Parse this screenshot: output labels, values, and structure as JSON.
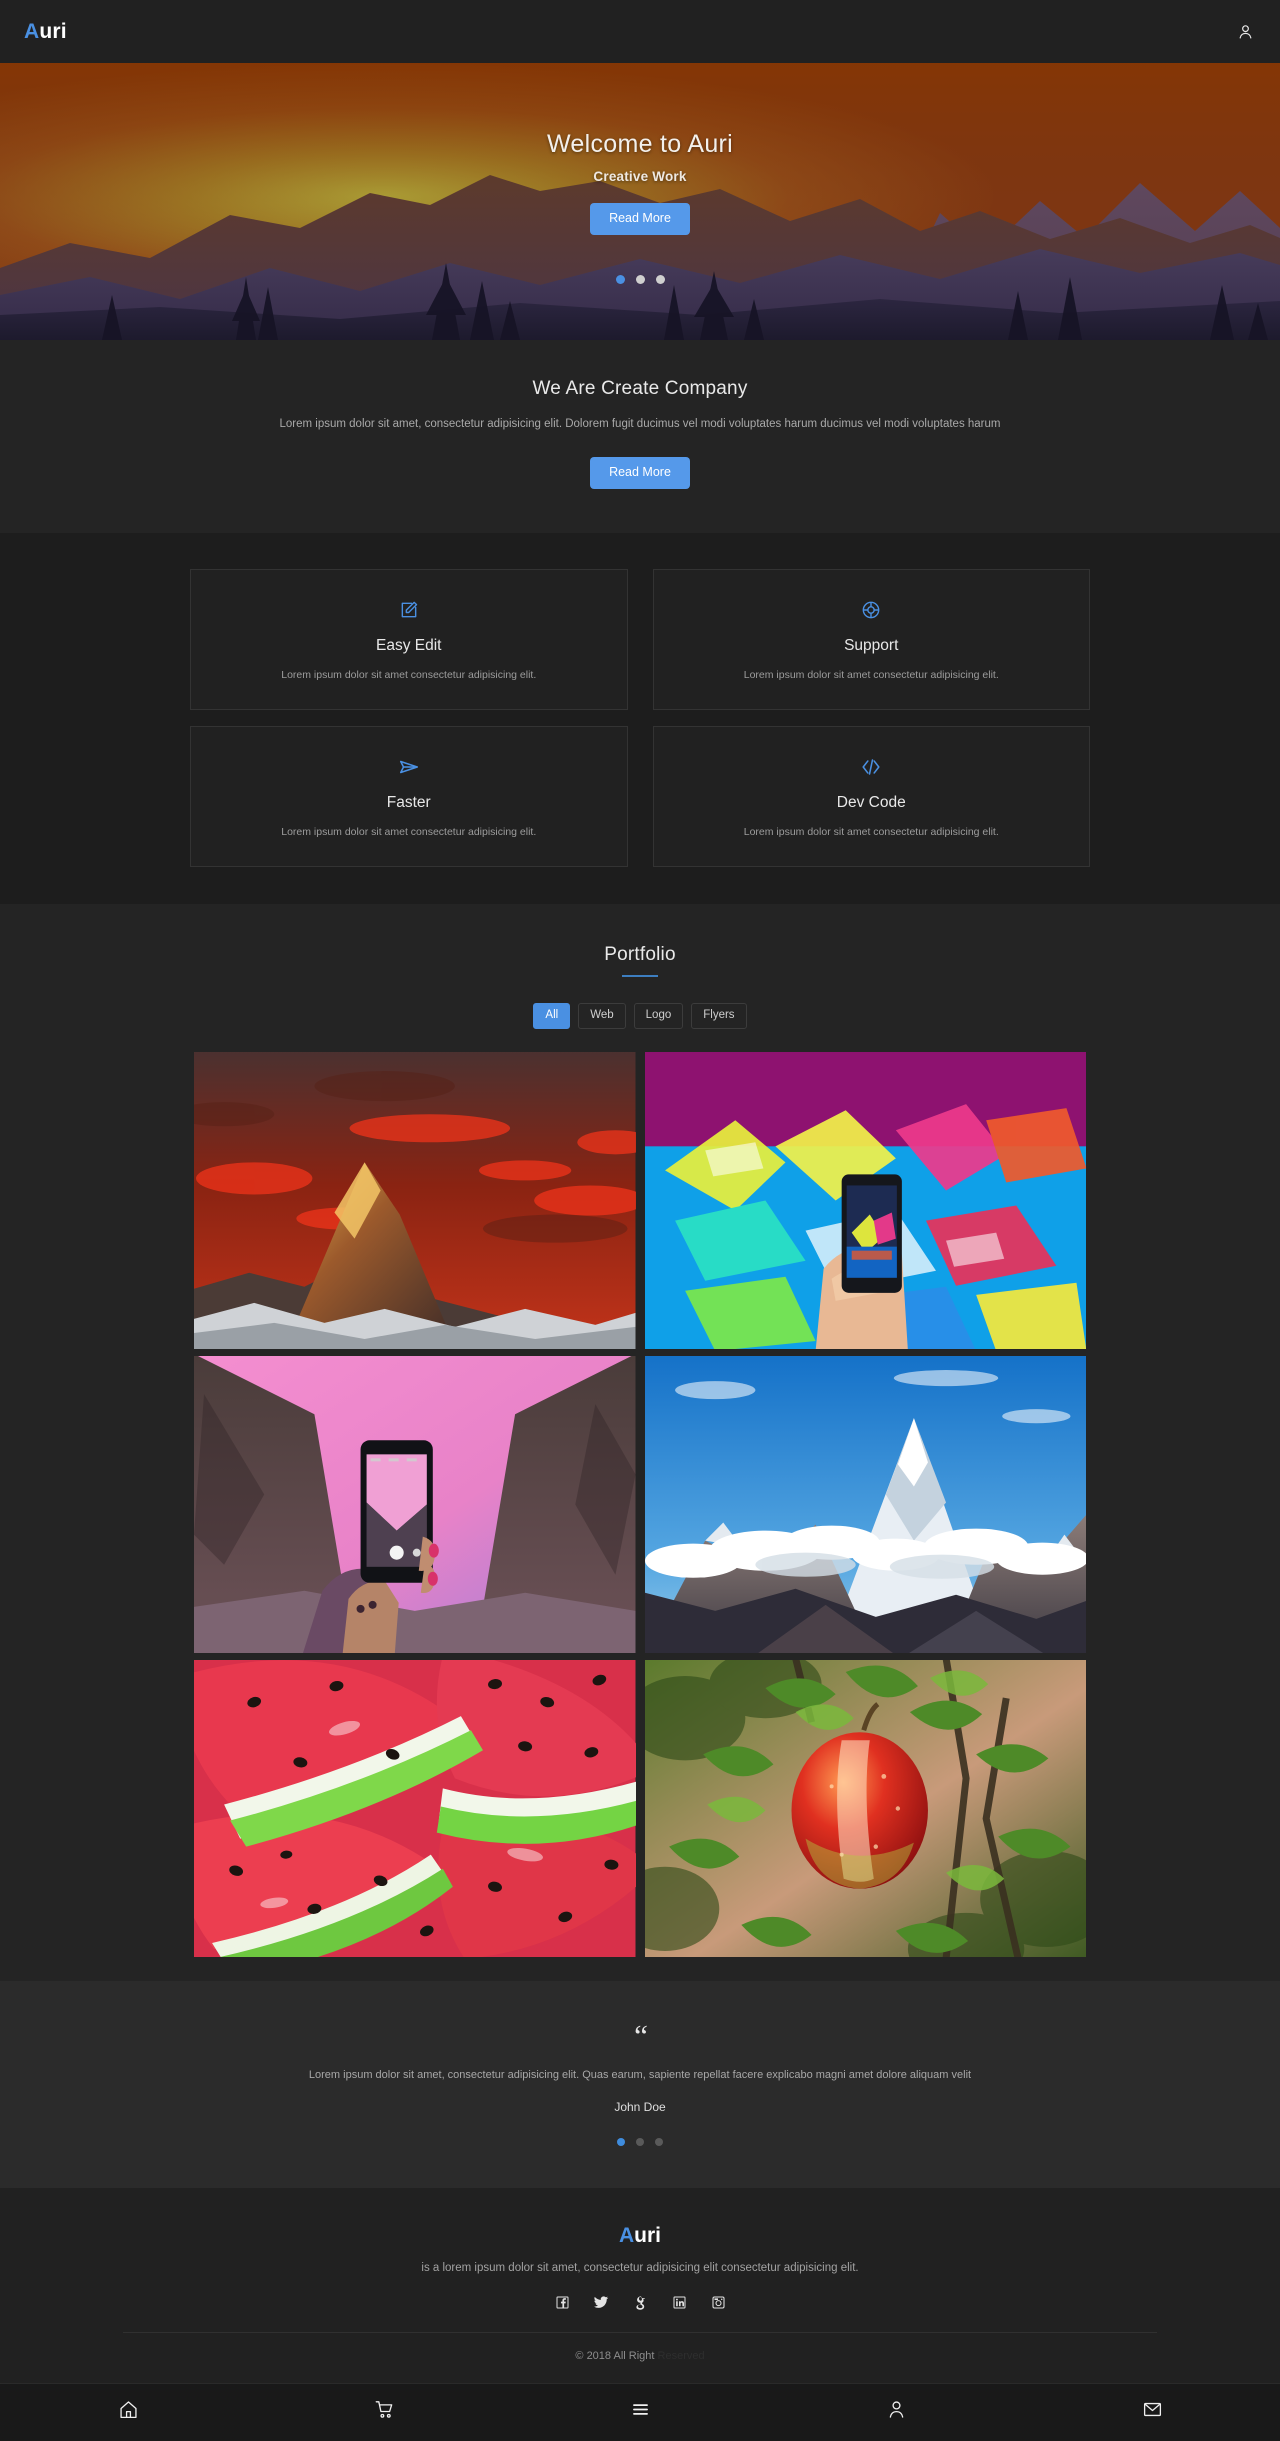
{
  "header": {
    "logo_accent": "A",
    "logo_rest": "uri",
    "account_icon": "user-icon"
  },
  "hero": {
    "title": "Welcome to Auri",
    "subtitle": "Creative Work",
    "cta_label": "Read More",
    "slides_count": 3,
    "active_slide": 1,
    "image_description": "sunset mountain landscape with pine trees"
  },
  "about": {
    "heading": "We Are Create Company",
    "paragraph": "Lorem ipsum dolor sit amet, consectetur adipisicing elit. Dolorem fugit ducimus vel modi voluptates harum ducimus vel modi voluptates harum",
    "cta_label": "Read More"
  },
  "features": [
    {
      "icon": "edit-square-icon",
      "title": "Easy Edit",
      "desc": "Lorem ipsum dolor sit amet consectetur adipisicing elit."
    },
    {
      "icon": "life-buoy-icon",
      "title": "Support",
      "desc": "Lorem ipsum dolor sit amet consectetur adipisicing elit."
    },
    {
      "icon": "paper-plane-icon",
      "title": "Faster",
      "desc": "Lorem ipsum dolor sit amet consectetur adipisicing elit."
    },
    {
      "icon": "code-brackets-icon",
      "title": "Dev Code",
      "desc": "Lorem ipsum dolor sit amet consectetur adipisicing elit."
    }
  ],
  "portfolio": {
    "heading": "Portfolio",
    "filters": [
      {
        "label": "All",
        "active": true
      },
      {
        "label": "Web",
        "active": false
      },
      {
        "label": "Logo",
        "active": false
      },
      {
        "label": "Flyers",
        "active": false
      }
    ],
    "items": [
      {
        "name": "matterhorn-red-sunset",
        "alt": "Mountain peak under red sunset sky"
      },
      {
        "name": "graffiti-phone-photo",
        "alt": "Hand holding phone photographing colourful graffiti wall"
      },
      {
        "name": "pink-sky-valley-phone",
        "alt": "Hand holding phone photographing pink sky valley"
      },
      {
        "name": "snow-peak-blue-sky",
        "alt": "Snow covered mountain peak against blue sky"
      },
      {
        "name": "watermelon-slices",
        "alt": "Sliced red watermelon close up"
      },
      {
        "name": "red-apple-on-tree",
        "alt": "Red apple hanging on green leafy tree"
      }
    ]
  },
  "testimonial": {
    "quote_glyph": "“",
    "text": "Lorem ipsum dolor sit amet, consectetur adipisicing elit. Quas earum, sapiente repellat facere explicabo magni amet dolore aliquam velit",
    "author": "John Doe",
    "slides_count": 3,
    "active_slide": 1
  },
  "footer": {
    "logo_accent": "A",
    "logo_rest": "uri",
    "tagline": "is a lorem ipsum dolor sit amet, consectetur adipisicing elit consectetur adipisicing elit.",
    "socials": [
      {
        "icon": "facebook-icon",
        "label": "Facebook"
      },
      {
        "icon": "twitter-icon",
        "label": "Twitter"
      },
      {
        "icon": "google-plus-icon",
        "label": "Google Plus"
      },
      {
        "icon": "linkedin-icon",
        "label": "LinkedIn"
      },
      {
        "icon": "instagram-icon",
        "label": "Instagram"
      }
    ],
    "copyright": "© 2018 All Right ",
    "copyright_dim": "Reserved"
  },
  "bottom_nav": [
    {
      "icon": "home-icon",
      "label": "Home"
    },
    {
      "icon": "cart-icon",
      "label": "Cart"
    },
    {
      "icon": "menu-icon",
      "label": "Menu"
    },
    {
      "icon": "user-icon",
      "label": "Account"
    },
    {
      "icon": "mail-icon",
      "label": "Mail"
    }
  ],
  "colors": {
    "accent": "#4a90e2",
    "button": "#5599ea",
    "page_bg": "#1c1c1c",
    "panel_bg": "#242424",
    "card_bg": "#212121"
  }
}
